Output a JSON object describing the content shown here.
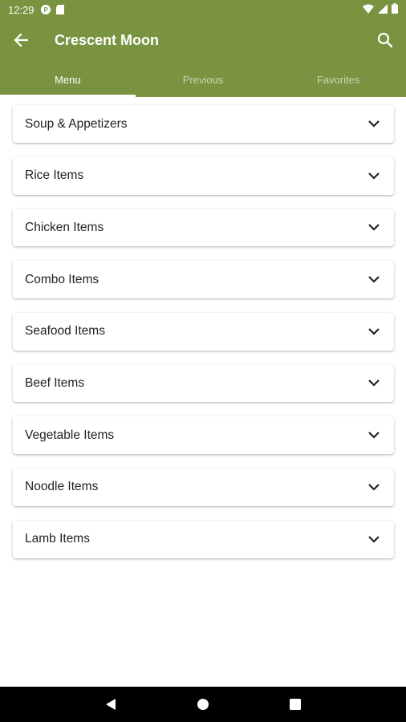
{
  "status": {
    "time": "12:29"
  },
  "toolbar": {
    "title": "Crescent Moon",
    "back_icon": "arrow-left-icon",
    "search_icon": "search-icon"
  },
  "tabs": [
    {
      "label": "Menu",
      "active": true
    },
    {
      "label": "Previous",
      "active": false
    },
    {
      "label": "Favorites",
      "active": false
    }
  ],
  "categories": [
    {
      "label": "Soup & Appetizers"
    },
    {
      "label": "Rice Items"
    },
    {
      "label": "Chicken Items"
    },
    {
      "label": "Combo Items"
    },
    {
      "label": "Seafood Items"
    },
    {
      "label": "Beef Items"
    },
    {
      "label": "Vegetable Items"
    },
    {
      "label": "Noodle Items"
    },
    {
      "label": "Lamb Items"
    }
  ],
  "colors": {
    "primary": "#7a9340",
    "navbar": "#000000",
    "text": "#222222"
  }
}
